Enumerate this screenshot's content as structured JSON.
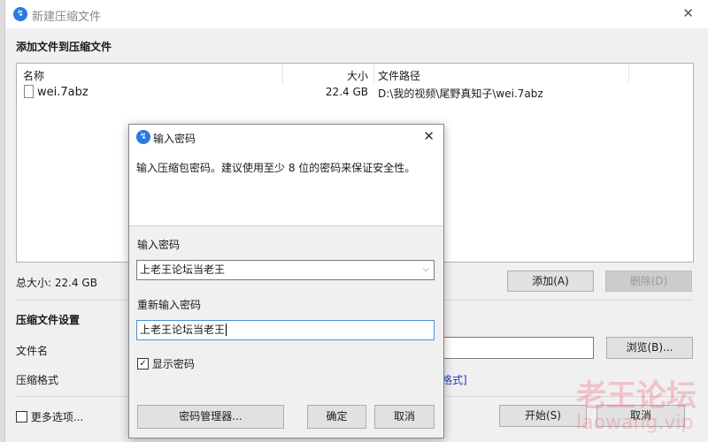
{
  "main": {
    "title": "新建压缩文件",
    "section_add": "添加文件到压缩文件",
    "columns": {
      "name": "名称",
      "size": "大小",
      "path": "文件路径"
    },
    "files": [
      {
        "name": "wei.7abz",
        "size": "22.4 GB",
        "path": "D:\\我的视频\\尾野真知子\\wei.7abz"
      }
    ],
    "total_size": "总大小: 22.4 GB",
    "add_button": "添加(A)",
    "delete_button": "删除(D)",
    "settings_heading": "压缩文件设置",
    "filename_label": "文件名",
    "browse_button": "浏览(B)...",
    "format_label": "压缩格式",
    "format_link": "格式]",
    "more_options": "更多选项...",
    "start_button": "开始(S)",
    "cancel_button": "取消",
    "close": "✕"
  },
  "dialog": {
    "title": "输入密码",
    "close": "✕",
    "description": "输入压缩包密码。建议使用至少 8 位的密码来保证安全性。",
    "password_label": "输入密码",
    "password_value": "上老王论坛当老王",
    "reenter_label": "重新输入密码",
    "reenter_value": "上老王论坛当老王",
    "show_password": "显示密码",
    "show_password_checked": true,
    "manager_button": "密码管理器...",
    "ok_button": "确定",
    "cancel_button": "取消"
  },
  "watermark": {
    "line1": "老王论坛",
    "line2": "laowang.vip"
  }
}
